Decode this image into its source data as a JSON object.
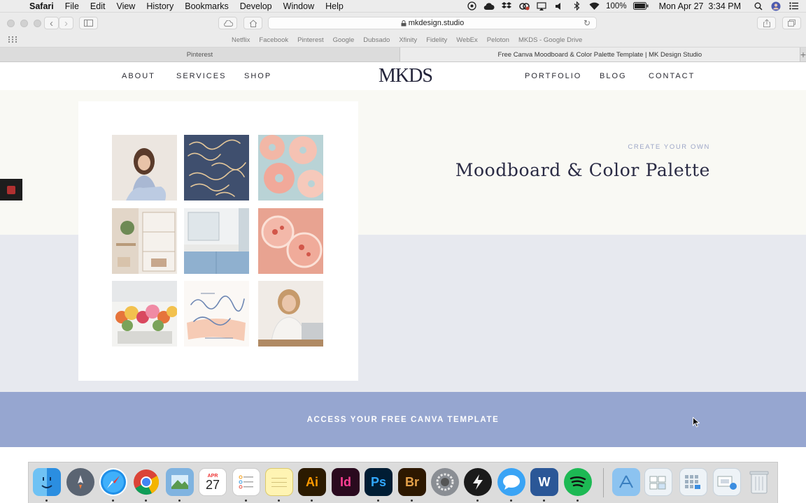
{
  "menubar": {
    "apple_glyph": "",
    "app_name": "Safari",
    "menus": [
      "File",
      "Edit",
      "View",
      "History",
      "Bookmarks",
      "Develop",
      "Window",
      "Help"
    ],
    "battery": "100%",
    "datetime": "Mon Apr 27  3:34 PM"
  },
  "toolbar": {
    "url": "mkdesign.studio",
    "back_icon": "‹",
    "forward_icon": "›",
    "reload_icon": "↻"
  },
  "favorites": [
    "Netflix",
    "Facebook",
    "Pinterest",
    "Google",
    "Dubsado",
    "Xfinity",
    "Fidelity",
    "WebEx",
    "Peloton",
    "MKDS - Google Drive"
  ],
  "tabs": [
    {
      "label": "Pinterest"
    },
    {
      "label": "Free Canva Moodboard & Color Palette Template | MK Design Studio"
    }
  ],
  "site": {
    "logo": "MKDS",
    "nav_left": [
      "ABOUT",
      "SERVICES",
      "SHOP"
    ],
    "nav_right": [
      "PORTFOLIO",
      "BLOG",
      "CONTACT"
    ],
    "eyebrow": "CREATE YOUR OWN",
    "headline": "Moodboard & Color Palette",
    "cta_label": "ACCESS YOUR FREE CANVA TEMPLATE",
    "colors": {
      "hero_top": "#f9f9f4",
      "hero_bottom": "#e7e9ef",
      "cta": "#96a6d0",
      "eyebrow": "#9da6c7",
      "headline": "#2a2b44"
    },
    "moodboard_tiles": [
      {
        "name": "woman-laughing-photo"
      },
      {
        "name": "hand-lettering-photo",
        "text": "else, GUARD your heart for everything you do flows"
      },
      {
        "name": "donuts-photo"
      },
      {
        "name": "kitchen-shelves-photo"
      },
      {
        "name": "bathroom-vanity-photo"
      },
      {
        "name": "pink-drinks-photo"
      },
      {
        "name": "flower-bouquets-photo"
      },
      {
        "name": "lettering-print-photo",
        "text": "you're beautiful capable WORTHY"
      },
      {
        "name": "woman-at-laptop-photo"
      }
    ]
  },
  "dock": [
    {
      "name": "finder"
    },
    {
      "name": "launchpad"
    },
    {
      "name": "safari"
    },
    {
      "name": "chrome"
    },
    {
      "name": "preview"
    },
    {
      "name": "calendar",
      "month": "APR",
      "day": "27"
    },
    {
      "name": "reminders"
    },
    {
      "name": "notes"
    },
    {
      "name": "illustrator",
      "label": "Ai"
    },
    {
      "name": "indesign",
      "label": "Id"
    },
    {
      "name": "photoshop",
      "label": "Ps"
    },
    {
      "name": "bridge",
      "label": "Br"
    },
    {
      "name": "system-preferences"
    },
    {
      "name": "flashcut"
    },
    {
      "name": "messages"
    },
    {
      "name": "word",
      "label": "W"
    },
    {
      "name": "spotify"
    },
    {
      "name": "applications-folder"
    },
    {
      "name": "documents-stack"
    },
    {
      "name": "downloads-stack"
    },
    {
      "name": "screenshot-stack"
    },
    {
      "name": "trash"
    }
  ]
}
